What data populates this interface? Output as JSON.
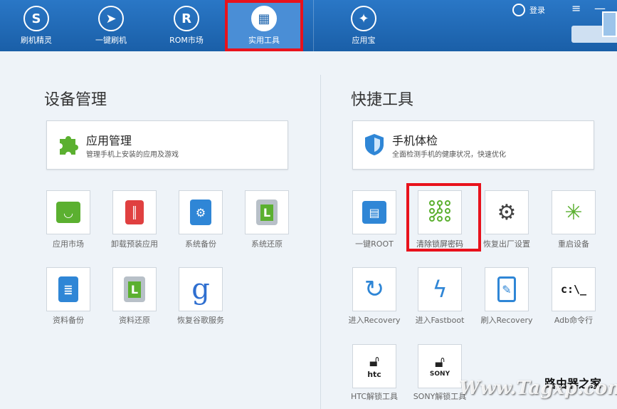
{
  "nav": {
    "items": [
      {
        "label": "刷机精灵",
        "icon": "shield-s-icon"
      },
      {
        "label": "一键刷机",
        "icon": "cursor-icon"
      },
      {
        "label": "ROM市场",
        "icon": "r-icon"
      },
      {
        "label": "实用工具",
        "icon": "grid-icon"
      },
      {
        "label": "应用宝",
        "icon": "yingyongbao-icon"
      }
    ],
    "login_label": "登录"
  },
  "device": {
    "title": "设备管理",
    "card": {
      "title": "应用管理",
      "desc": "管理手机上安装的应用及游戏"
    },
    "tiles": [
      "应用市场",
      "卸载预装应用",
      "系统备份",
      "系统还原",
      "资料备份",
      "资料还原",
      "恢复谷歌服务"
    ]
  },
  "quick": {
    "title": "快捷工具",
    "card": {
      "title": "手机体检",
      "desc": "全面检测手机的健康状况，快速优化"
    },
    "tiles": [
      "一键ROOT",
      "清除锁屏密码",
      "恢复出厂设置",
      "重启设备",
      "进入Recovery",
      "进入Fastboot",
      "刷入Recovery",
      "Adb命令行",
      "HTC解锁工具",
      "SONY解锁工具"
    ],
    "adb_glyph": "c:\\_",
    "htc_text": "htc",
    "sony_text": "SONY"
  },
  "watermark": {
    "url": "Www.Tagxp.com",
    "site": "路由器之家"
  },
  "colors": {
    "accent": "#1d64ae",
    "highlight": "#e8121c",
    "green": "#5bb030",
    "red": "#e04040",
    "blue": "#2f86d6"
  }
}
